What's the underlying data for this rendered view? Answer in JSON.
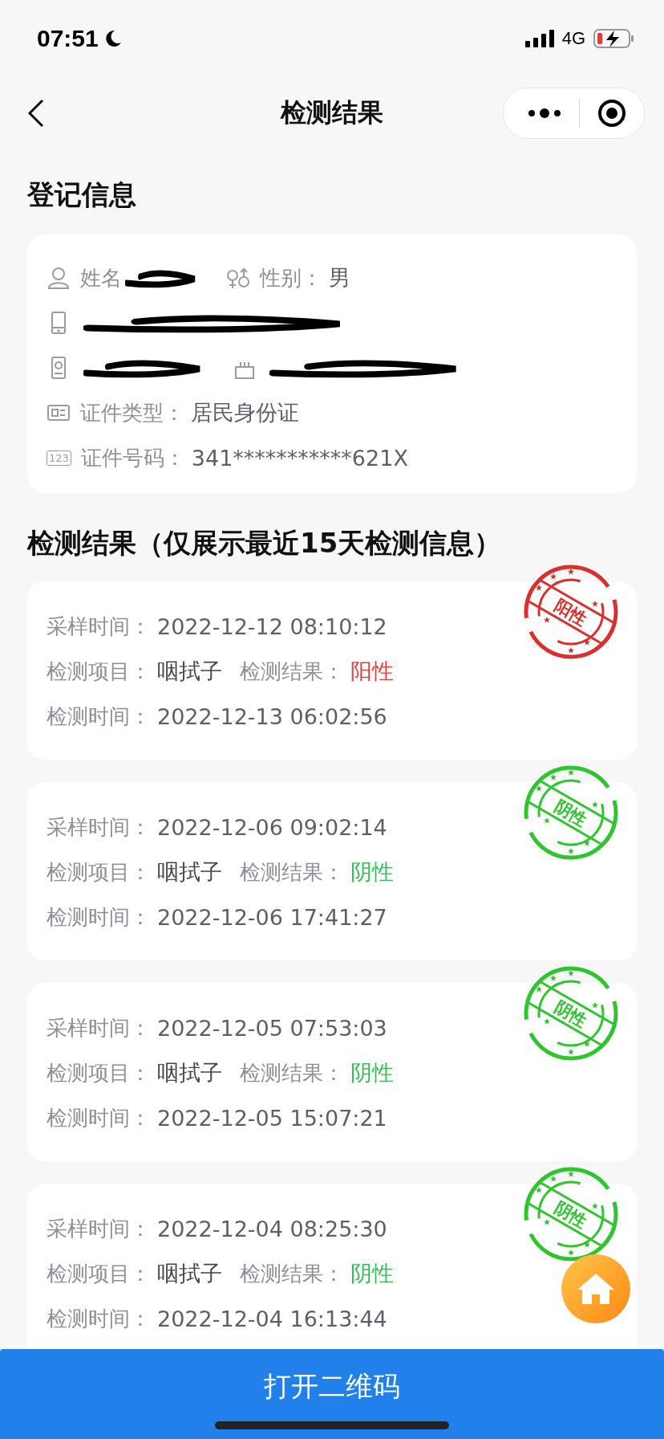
{
  "status_bar": {
    "time": "07:51",
    "network": "4G",
    "battery_low": true
  },
  "nav": {
    "title": "检测结果"
  },
  "registration": {
    "title": "登记信息",
    "rows": [
      {
        "fields": [
          {
            "label": "姓名",
            "redacted": true
          },
          {
            "label": "性别：",
            "value": "男"
          }
        ]
      },
      {
        "fields": [
          {
            "redacted": true
          }
        ]
      },
      {
        "fields": [
          {
            "redacted": true
          },
          {
            "redacted": true
          }
        ]
      },
      {
        "fields": [
          {
            "label": "证件类型：",
            "value": "居民身份证"
          }
        ]
      },
      {
        "fields": [
          {
            "icon_text": "123",
            "label": "证件号码：",
            "value": "341***********621X"
          }
        ]
      }
    ]
  },
  "results": {
    "title": "检测结果（仅展示最近15天检测信息）",
    "items": [
      {
        "sample_label": "采样时间：",
        "sample_time": "2022-12-12 08:10:12",
        "item_label": "检测项目：",
        "item": "咽拭子",
        "result_label": "检测结果：",
        "result": "阳性",
        "kind": "positive",
        "stamp": "阳性",
        "test_label": "检测时间：",
        "test_time": "2022-12-13 06:02:56"
      },
      {
        "sample_label": "采样时间：",
        "sample_time": "2022-12-06 09:02:14",
        "item_label": "检测项目：",
        "item": "咽拭子",
        "result_label": "检测结果：",
        "result": "阴性",
        "kind": "negative",
        "stamp": "阴性",
        "test_label": "检测时间：",
        "test_time": "2022-12-06 17:41:27"
      },
      {
        "sample_label": "采样时间：",
        "sample_time": "2022-12-05 07:53:03",
        "item_label": "检测项目：",
        "item": "咽拭子",
        "result_label": "检测结果：",
        "result": "阴性",
        "kind": "negative",
        "stamp": "阴性",
        "test_label": "检测时间：",
        "test_time": "2022-12-05 15:07:21"
      },
      {
        "sample_label": "采样时间：",
        "sample_time": "2022-12-04 08:25:30",
        "item_label": "检测项目：",
        "item": "咽拭子",
        "result_label": "检测结果：",
        "result": "阴性",
        "kind": "negative",
        "stamp": "阴性",
        "test_label": "检测时间：",
        "test_time": "2022-12-04 16:13:44"
      }
    ]
  },
  "bottom_button": "打开二维码"
}
